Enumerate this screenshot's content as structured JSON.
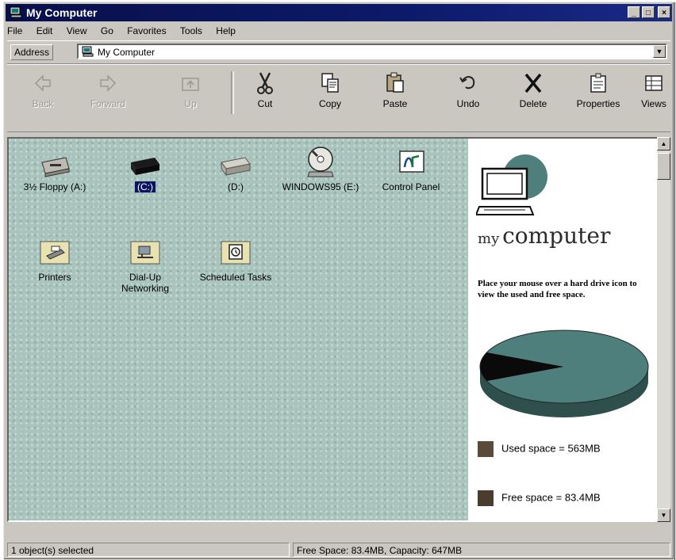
{
  "window": {
    "title": "My Computer",
    "controls": {
      "minimize": "_",
      "maximize": "□",
      "close": "×"
    }
  },
  "menu": [
    "File",
    "Edit",
    "View",
    "Go",
    "Favorites",
    "Tools",
    "Help"
  ],
  "address": {
    "label": "Address",
    "value": "My Computer",
    "dropdown_arrow": "▼"
  },
  "toolbar": [
    {
      "label": "Back",
      "icon": "back-arrow-icon",
      "enabled": false
    },
    {
      "label": "Forward",
      "icon": "forward-arrow-icon",
      "enabled": false
    },
    {
      "label": "Up",
      "icon": "up-folder-icon",
      "enabled": false
    },
    {
      "label": "Cut",
      "icon": "scissors-icon",
      "enabled": true
    },
    {
      "label": "Copy",
      "icon": "copy-icon",
      "enabled": true
    },
    {
      "label": "Paste",
      "icon": "paste-icon",
      "enabled": true
    },
    {
      "label": "Undo",
      "icon": "undo-icon",
      "enabled": true
    },
    {
      "label": "Delete",
      "icon": "delete-x-icon",
      "enabled": true
    },
    {
      "label": "Properties",
      "icon": "properties-icon",
      "enabled": true
    },
    {
      "label": "Views",
      "icon": "views-icon",
      "enabled": true
    }
  ],
  "items": [
    {
      "label": "3½ Floppy (A:)",
      "icon": "floppy-drive-icon",
      "selected": false
    },
    {
      "label": "(C:)",
      "icon": "hard-drive-icon",
      "selected": true
    },
    {
      "label": "(D:)",
      "icon": "hard-drive-icon",
      "selected": false
    },
    {
      "label": "WINDOWS95 (E:)",
      "icon": "cd-rom-icon",
      "selected": false
    },
    {
      "label": "Control Panel",
      "icon": "control-panel-icon",
      "selected": false
    },
    {
      "label": "Printers",
      "icon": "printer-folder-icon",
      "selected": false
    },
    {
      "label": "Dial-Up Networking",
      "icon": "dialup-folder-icon",
      "selected": false
    },
    {
      "label": "Scheduled Tasks",
      "icon": "scheduled-tasks-icon",
      "selected": false
    }
  ],
  "info_panel": {
    "title_small": "my",
    "title_big": "computer",
    "description": "Place your mouse over a hard drive icon to view the used and free space.",
    "used_label": "Used space = 563MB",
    "free_label": "Free space = 83.4MB",
    "used_mb": 563,
    "free_mb": 83.4,
    "used_color": "#5a4a3a",
    "free_color": "#4a3d2e",
    "pie_top_color": "#4f7f7c",
    "pie_slice_color": "#0a0a0a"
  },
  "status": {
    "left": "1 object(s) selected",
    "right": "Free Space: 83.4MB,  Capacity: 647MB"
  }
}
